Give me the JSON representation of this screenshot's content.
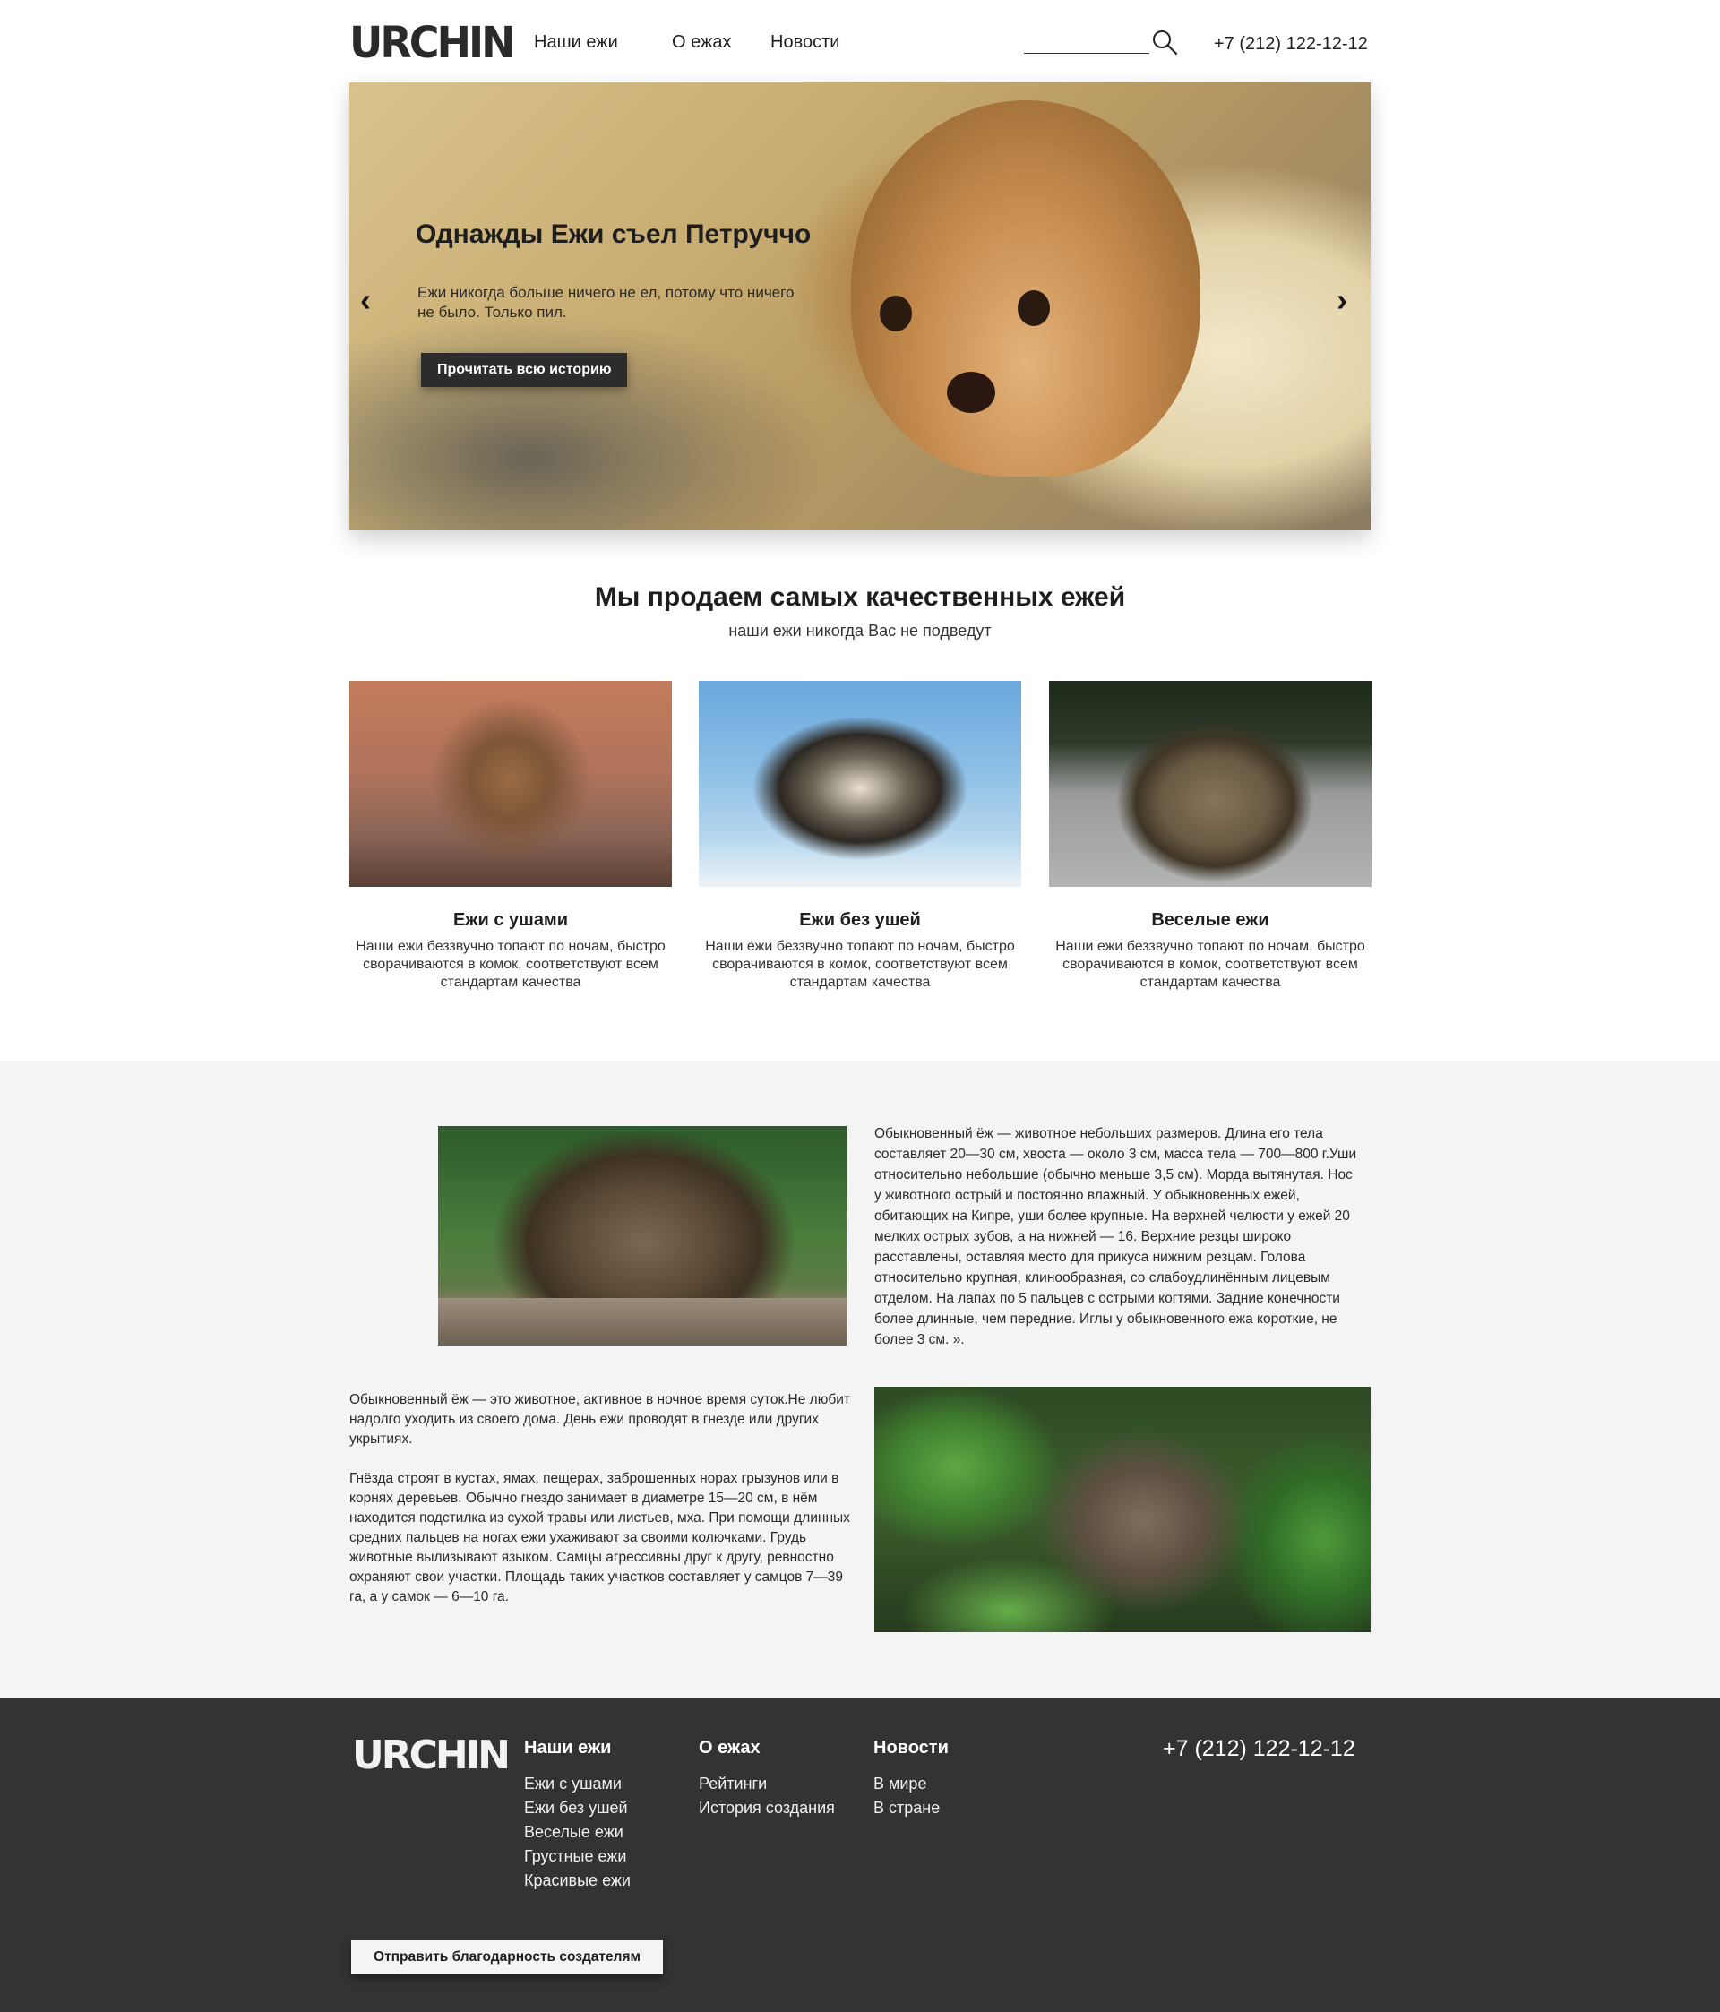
{
  "brand": {
    "logo_text": "URCHIN"
  },
  "header": {
    "nav": [
      "Наши ежи",
      "О ежах",
      "Новости"
    ],
    "search_placeholder": "",
    "phone": "+7 (212) 122-12-12"
  },
  "hero": {
    "title": "Однажды Ежи съел Петруччо",
    "text": "Ежи никогда больше ничего не ел, потому что ничего не было. Только пил.",
    "button": "Прочитать всю историю",
    "prev_arrow": "‹",
    "next_arrow": "›"
  },
  "products": {
    "title": "Мы продаем самых качественных ежей",
    "subtitle": "наши ежи никогда Вас не подведут",
    "cards": [
      {
        "title": "Ежи с ушами",
        "desc": "Наши ежи беззвучно топают по ночам, быстро сворачиваются в комок, соответствуют всем стандартам качества"
      },
      {
        "title": "Ежи без ушей",
        "desc": "Наши ежи беззвучно топают по ночам, быстро сворачиваются в комок, соответствуют всем стандартам качества"
      },
      {
        "title": "Веселые ежи",
        "desc": "Наши ежи беззвучно топают по ночам, быстро сворачиваются в комок, соответствуют всем стандартам качества"
      }
    ]
  },
  "info": {
    "text_right": "Обыкновенный ёж — животное небольших размеров. Длина его тела составляет 20—30 см, хвоста — около 3 см, масса тела — 700—800 г.Уши относительно небольшие (обычно меньше 3,5 см). Морда вытянутая. Нос у животного острый и постоянно влажный. У обыкновенных ежей, обитающих на Кипре, уши более крупные. На верхней челюсти у ежей 20 мелких острых зубов, а на нижней — 16. Верхние резцы широко расставлены, оставляя место для прикуса нижним резцам. Голова относительно крупная, клинообразная, со слабоудлинённым лицевым отделом. На лапах по 5 пальцев с острыми когтями. Задние конечности более длинные, чем передние. Иглы у обыкновенного ежа короткие, не более 3 см. ».",
    "text_left_1": "Обыкновенный ёж — это животное, активное в ночное время суток.Не любит надолго уходить из своего дома. День ежи проводят в гнезде или других укрытиях.",
    "text_left_2": "Гнёзда строят в кустах, ямах, пещерах, заброшенных норах грызунов или в корнях деревьев. Обычно гнездо занимает в диаметре 15—20 см, в нём находится подстилка из сухой травы или листьев, мха. При помощи длинных средних пальцев на ногах ежи ухаживают за своими колючками. Грудь животные вылизывают языком. Самцы агрессивны друг к другу, ревностно охраняют свои участки. Площадь таких участков составляет у самцов 7—39 га, а у самок — 6—10 га."
  },
  "footer": {
    "columns": [
      {
        "title": "Наши ежи",
        "items": [
          "Ежи с ушами",
          "Ежи без ушей",
          "Веселые ежи",
          "Грустные ежи",
          "Красивые ежи"
        ]
      },
      {
        "title": "О ежах",
        "items": [
          "Рейтинги",
          "История создания"
        ]
      },
      {
        "title": "Новости",
        "items": [
          "В мире",
          "В стране"
        ]
      }
    ],
    "phone": "+7 (212) 122-12-12",
    "thanks_button": "Отправить благодарность создателям"
  },
  "icons": {
    "search": "search-icon",
    "prev": "chevron-left-icon",
    "next": "chevron-right-icon"
  }
}
